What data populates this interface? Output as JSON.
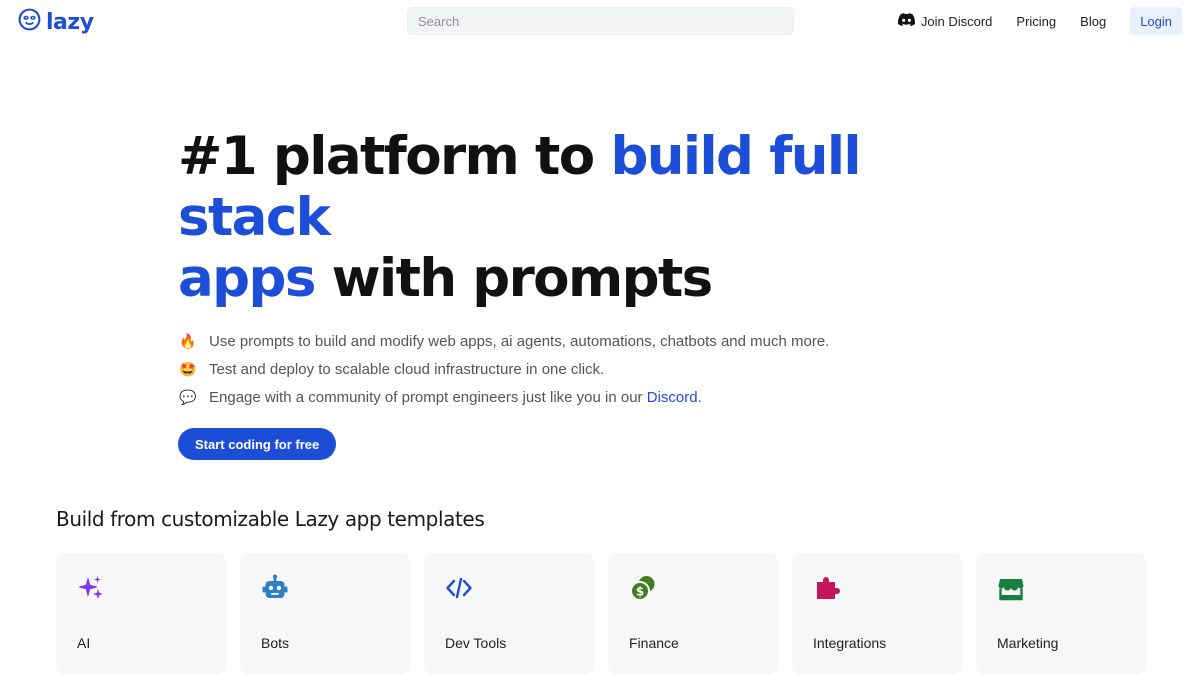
{
  "header": {
    "logo_text": "lazy",
    "search_placeholder": "Search",
    "nav": {
      "discord_label": "Join Discord",
      "pricing_label": "Pricing",
      "blog_label": "Blog",
      "login_label": "Login"
    }
  },
  "hero": {
    "title_part1": "#1 platform to ",
    "title_accent1": "build full stack",
    "title_accent2": "apps",
    "title_part2": " with prompts",
    "features": [
      {
        "emoji": "🔥",
        "icon": "fire-icon",
        "text": "Use prompts to build and modify web apps, ai agents, automations, chatbots and much more."
      },
      {
        "emoji": "🤩",
        "icon": "star-struck-icon",
        "text": "Test and deploy to scalable cloud infrastructure in one click."
      },
      {
        "emoji": "💬",
        "icon": "speech-bubble-icon",
        "text_before": "Engage with a community of prompt engineers just like you in our ",
        "link_text": "Discord",
        "text_after": "."
      }
    ],
    "cta_label": "Start coding for free"
  },
  "templates": {
    "heading": "Build from customizable Lazy app templates",
    "cards": [
      {
        "label": "AI",
        "icon": "sparkles-icon",
        "color": "#7c3aed"
      },
      {
        "label": "Bots",
        "icon": "robot-icon",
        "color": "#2b7fc4"
      },
      {
        "label": "Dev Tools",
        "icon": "code-icon",
        "color": "#1d4ed8"
      },
      {
        "label": "Finance",
        "icon": "coins-icon",
        "color": "#3f7d20"
      },
      {
        "label": "Integrations",
        "icon": "puzzle-icon",
        "color": "#c2185b"
      },
      {
        "label": "Marketing",
        "icon": "storefront-icon",
        "color": "#15803d"
      }
    ]
  },
  "colors": {
    "brand": "#1d4ed8",
    "login_bg": "#eaf0fc",
    "card_bg": "#f7f7f8"
  }
}
